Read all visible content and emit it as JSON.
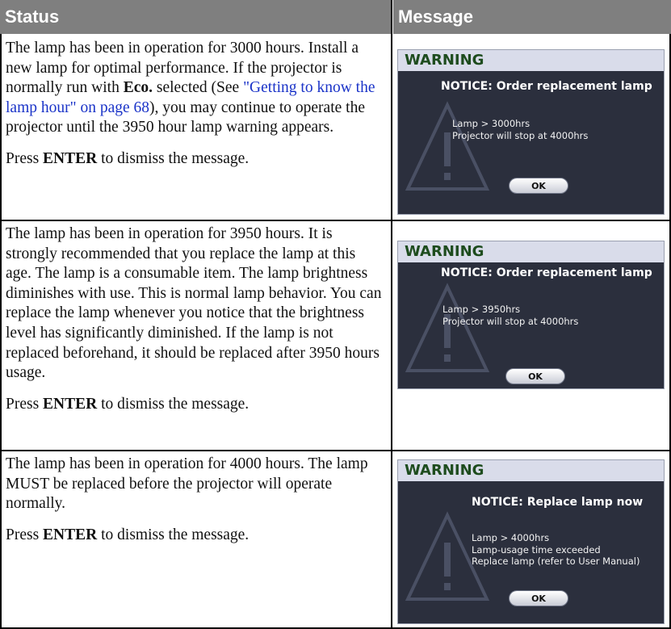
{
  "headers": {
    "status": "Status",
    "message": "Message"
  },
  "rows": [
    {
      "status_p1_a": "The lamp has been in operation for 3000 hours. Install a new lamp for optimal performance. If the projector is normally run with ",
      "status_p1_bold": "Eco.",
      "status_p1_b": " selected (See ",
      "status_p1_link": "\"Getting to know the lamp hour\" on page 68",
      "status_p1_c": "), you may continue to operate the projector until the 3950 hour lamp warning appears.",
      "press_a": "Press ",
      "press_bold": "ENTER",
      "press_b": " to dismiss the message.",
      "dialog": {
        "title": "WARNING",
        "notice": "NOTICE: Order replacement lamp",
        "lines": [
          "Lamp > 3000hrs",
          "Projector will stop at 4000hrs"
        ],
        "ok": "OK"
      }
    },
    {
      "status_p1": "The lamp has been in operation for 3950 hours. It is strongly recommended that you replace the lamp at this age. The lamp is a consumable item. The lamp brightness diminishes with use. This is normal lamp behavior. You can replace the lamp whenever you notice that the brightness level has significantly diminished. If the lamp is not replaced beforehand, it should be replaced after 3950 hours usage.",
      "press_a": "Press ",
      "press_bold": "ENTER",
      "press_b": " to dismiss the message.",
      "dialog": {
        "title": "WARNING",
        "notice": "NOTICE: Order replacement lamp",
        "lines": [
          "Lamp > 3950hrs",
          "Projector will stop at 4000hrs"
        ],
        "ok": "OK"
      }
    },
    {
      "status_p1": "The lamp has been in operation for 4000 hours. The lamp MUST be replaced before the projector will operate normally.",
      "press_a": "Press ",
      "press_bold": "ENTER",
      "press_b": " to dismiss the message.",
      "dialog": {
        "title": "WARNING",
        "notice": "NOTICE: Replace lamp now",
        "lines": [
          "Lamp > 4000hrs",
          "Lamp-usage time exceeded",
          "Replace lamp (refer to User Manual)"
        ],
        "ok": "OK"
      }
    }
  ]
}
